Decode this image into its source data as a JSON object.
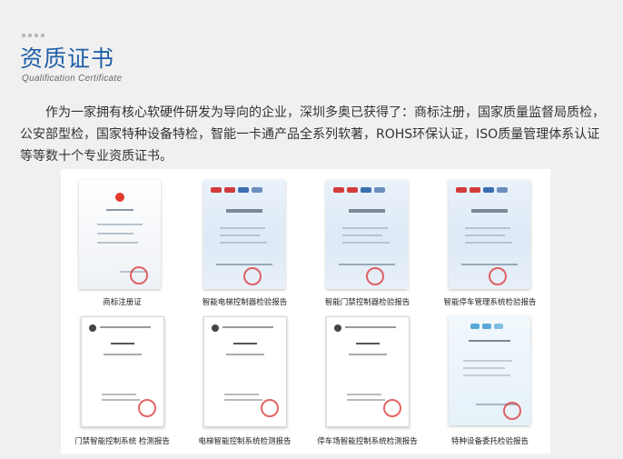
{
  "header": {
    "title": "资质证书",
    "subtitle": "Qualification Certificate"
  },
  "intro": "作为一家拥有核心软硬件研发为导向的企业，深圳多奥已获得了：商标注册，国家质量监督局质检，公安部型检，国家特种设备特检，智能一卡通产品全系列软著，ROHS环保认证，ISO质量管理体系认证等等数十个专业资质证书。",
  "certificates": [
    {
      "caption": "商标注册证",
      "style": "tm"
    },
    {
      "caption": "智能电梯控制器检验报告",
      "style": "inspect"
    },
    {
      "caption": "智能门禁控制器检验报告",
      "style": "inspect"
    },
    {
      "caption": "智能停车管理系统检验报告",
      "style": "inspect"
    },
    {
      "caption": "门禁智能控制系统 检测报告",
      "style": "plain"
    },
    {
      "caption": "电梯智能控制系统检测报告",
      "style": "plain"
    },
    {
      "caption": "停车场智能控制系统检测报告",
      "style": "plain"
    },
    {
      "caption": "特种设备委托检验报告",
      "style": "special"
    }
  ],
  "colors": {
    "title": "#1f5fa8",
    "stamp": "#dc3232",
    "panel": "#ffffff",
    "background": "#f0f0f0"
  }
}
